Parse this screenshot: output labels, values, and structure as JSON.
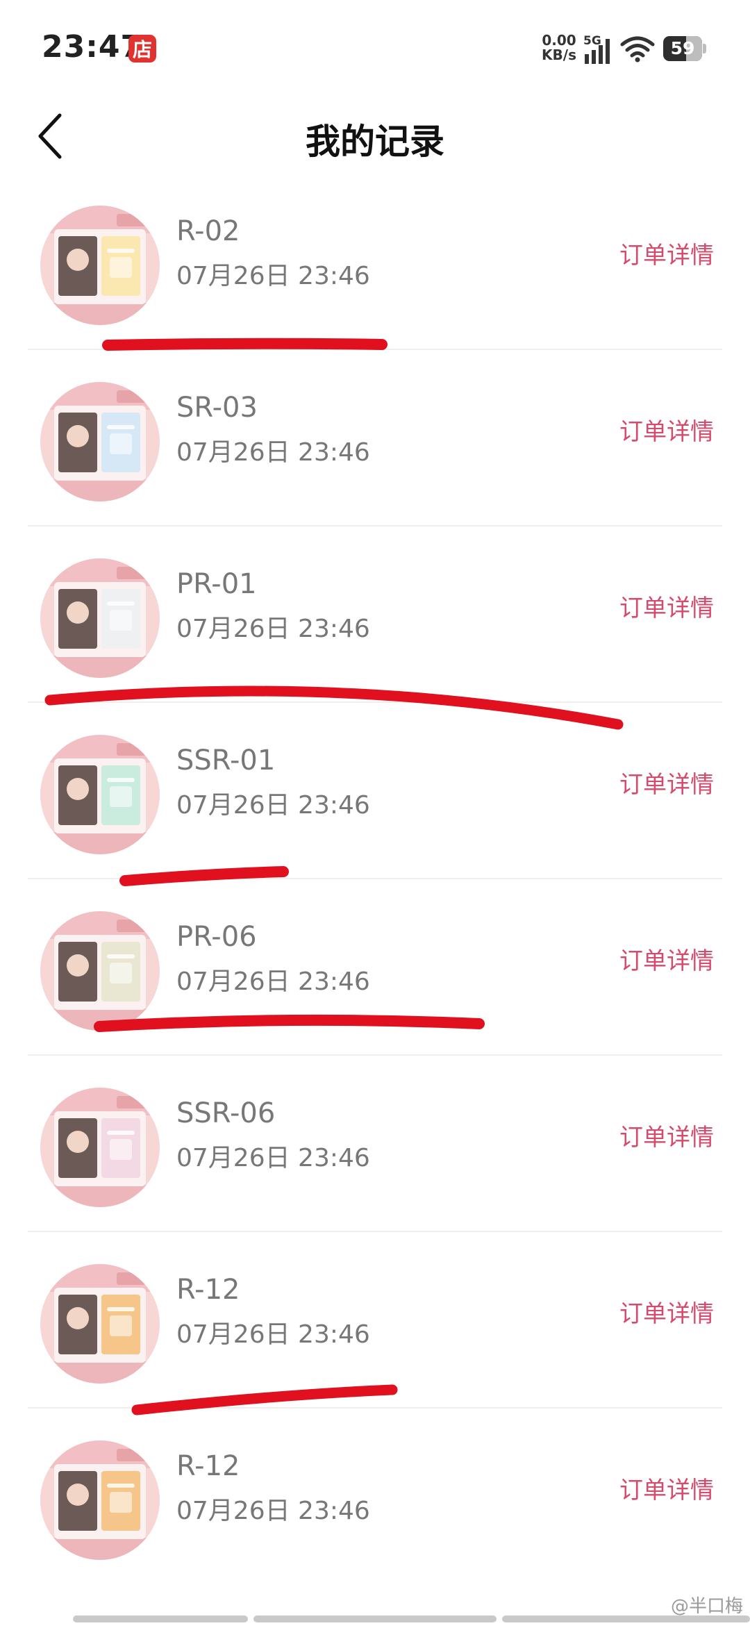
{
  "status_bar": {
    "time": "23:47",
    "store_badge": "店",
    "net_speed_value": "0.00",
    "net_speed_unit": "KB/s",
    "network_type": "5G",
    "battery_level": "59",
    "battery_fraction": 0.59
  },
  "header": {
    "title": "我的记录",
    "back_icon": "chevron-left-icon"
  },
  "records": [
    {
      "code": "R-02",
      "time": "07月26日 23:46",
      "detail_label": "订单详情"
    },
    {
      "code": "SR-03",
      "time": "07月26日 23:46",
      "detail_label": "订单详情"
    },
    {
      "code": "PR-01",
      "time": "07月26日 23:46",
      "detail_label": "订单详情"
    },
    {
      "code": "SSR-01",
      "time": "07月26日 23:46",
      "detail_label": "订单详情"
    },
    {
      "code": "PR-06",
      "time": "07月26日 23:46",
      "detail_label": "订单详情"
    },
    {
      "code": "SSR-06",
      "time": "07月26日 23:46",
      "detail_label": "订单详情"
    },
    {
      "code": "R-12",
      "time": "07月26日 23:46",
      "detail_label": "订单详情"
    },
    {
      "code": "R-12",
      "time": "07月26日 23:46",
      "detail_label": "订单详情"
    }
  ],
  "watermark": "@半口梅",
  "colors": {
    "accent": "#d64a6b",
    "scribble": "#e0101e",
    "thumb_bg": "#f7d6d6"
  }
}
